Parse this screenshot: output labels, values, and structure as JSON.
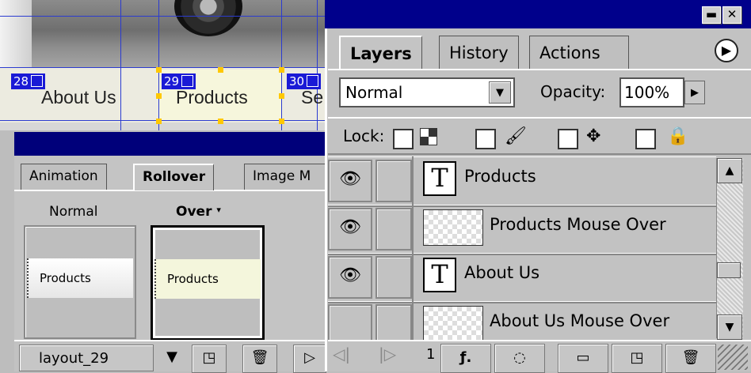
{
  "canvas": {
    "slices": [
      {
        "num": "28",
        "nav_text": "About Us"
      },
      {
        "num": "29",
        "nav_text": "Products"
      },
      {
        "num": "30",
        "nav_text": "Se"
      }
    ]
  },
  "rollover_panel": {
    "tabs": [
      "Animation",
      "Rollover",
      "Image M"
    ],
    "active_tab": "Rollover",
    "states": [
      {
        "label": "Normal",
        "thumb_text": "Products"
      },
      {
        "label": "Over",
        "thumb_text": "Products"
      }
    ],
    "slice_select_value": "layout_29"
  },
  "layers_panel": {
    "tabs": [
      "Layers",
      "History",
      "Actions"
    ],
    "active_tab": "Layers",
    "blend_mode": "Normal",
    "opacity_label": "Opacity:",
    "opacity_value": "100%",
    "lock_label": "Lock:",
    "layers": [
      {
        "name": "Products",
        "kind": "text",
        "thumb_glyph": "T",
        "visible": true
      },
      {
        "name": "Products Mouse Over",
        "kind": "pixel",
        "visible": true
      },
      {
        "name": "About Us",
        "kind": "text",
        "thumb_glyph": "T",
        "visible": true
      },
      {
        "name": "About Us Mouse Over",
        "kind": "pixel",
        "visible": false
      }
    ],
    "footer_num": "1"
  },
  "icons": [
    "eye-icon",
    "brush-icon",
    "move-icon",
    "padlock-icon",
    "trash-icon",
    "new-layer-icon",
    "folder-icon",
    "mask-icon",
    "layer-style-icon",
    "panel-menu-icon"
  ],
  "colors": {
    "title_bar": "#00007a",
    "slice_tag": "#1a1ad6",
    "guide": "#2b3bd0",
    "handle": "#ffc800"
  }
}
